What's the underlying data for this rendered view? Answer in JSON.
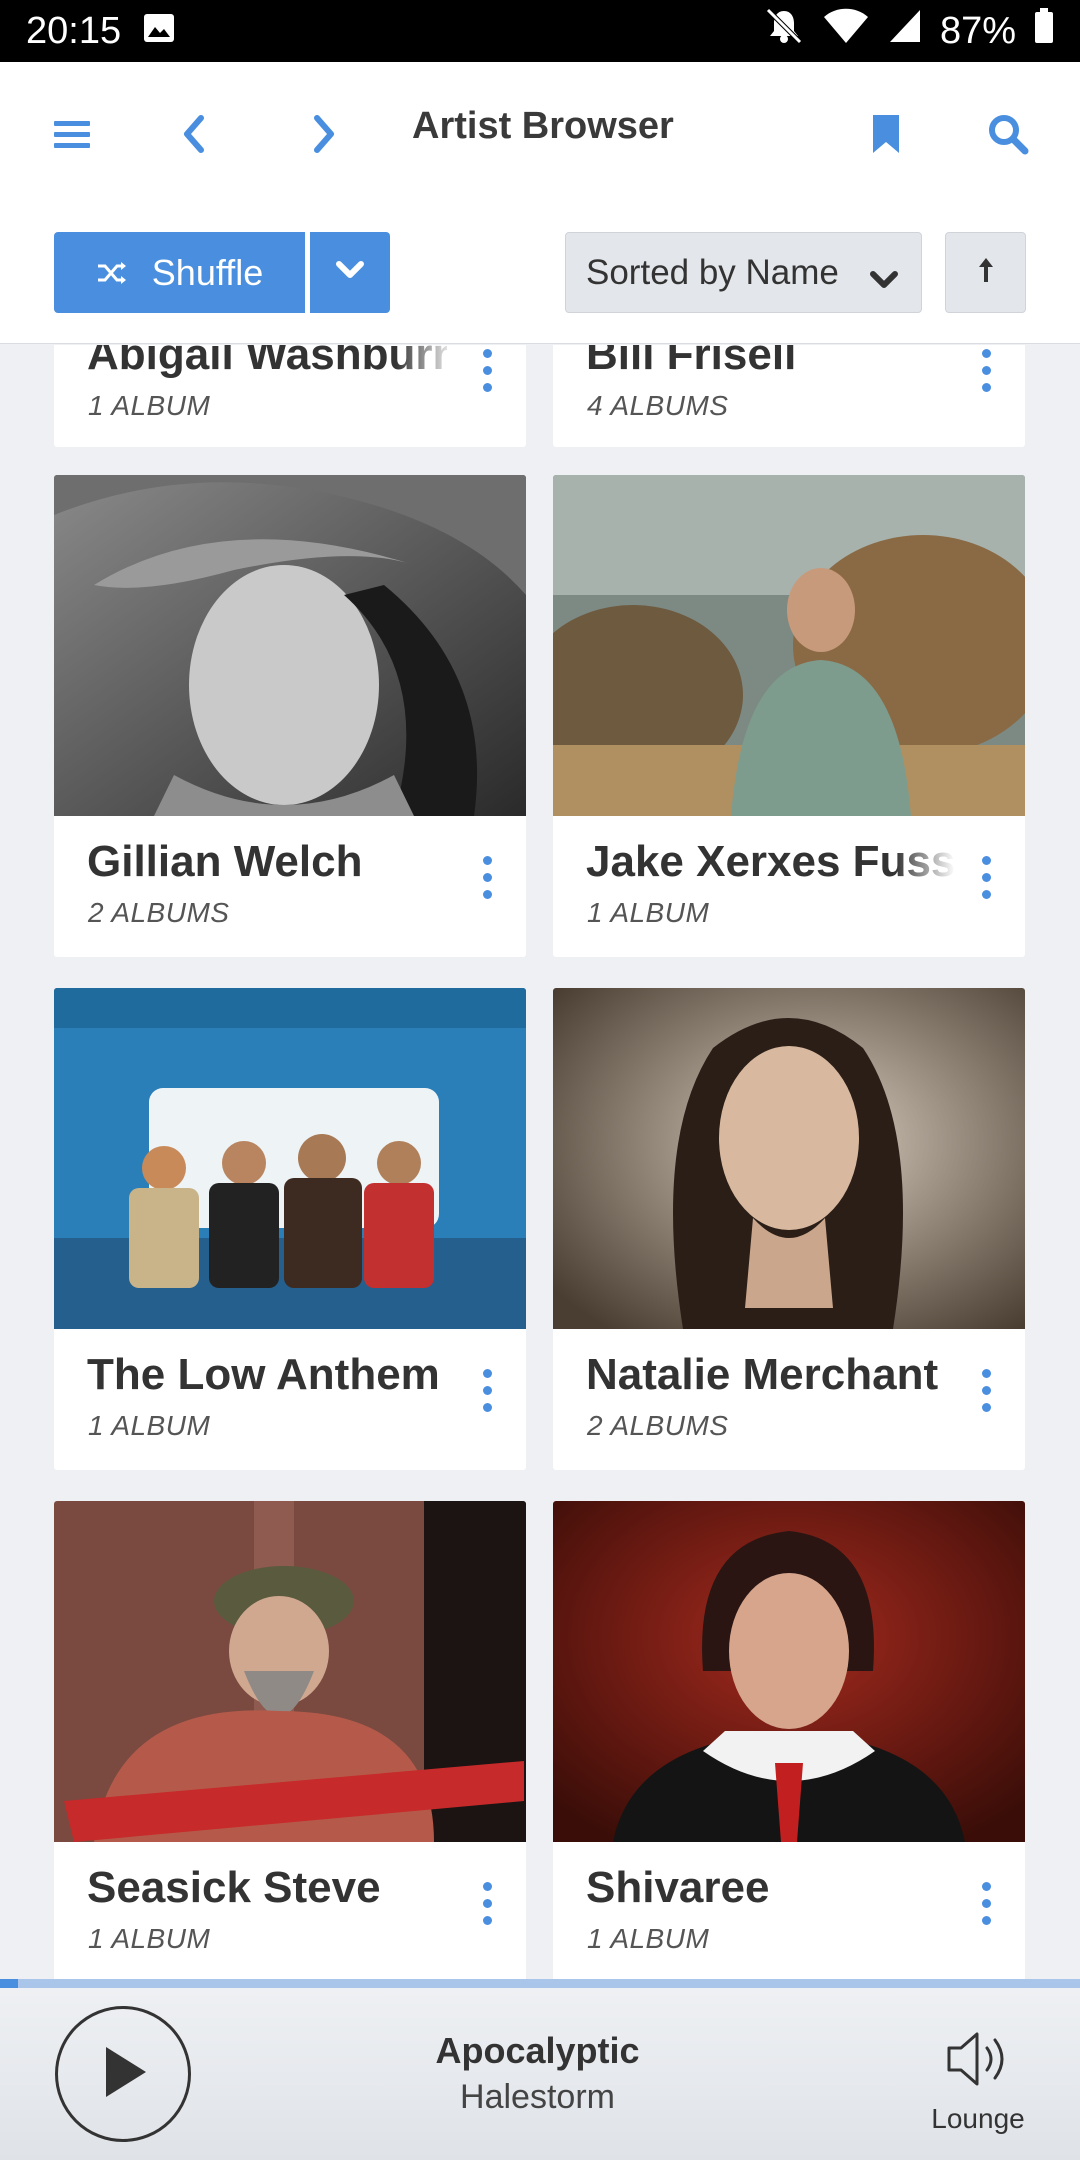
{
  "status_bar": {
    "time": "20:15",
    "battery": "87%"
  },
  "header": {
    "title": "Artist Browser",
    "shuffle_label": "Shuffle",
    "sort_label": "Sorted by Name"
  },
  "artists": [
    {
      "name": "Abigail Washburn",
      "count": "1 ALBUM"
    },
    {
      "name": "Bill Frisell",
      "count": "4 ALBUMS"
    },
    {
      "name": "Gillian Welch",
      "count": "2 ALBUMS"
    },
    {
      "name": "Jake Xerxes Fussell",
      "count": "1 ALBUM"
    },
    {
      "name": "The Low Anthem",
      "count": "1 ALBUM"
    },
    {
      "name": "Natalie Merchant",
      "count": "2 ALBUMS"
    },
    {
      "name": "Seasick Steve",
      "count": "1 ALBUM"
    },
    {
      "name": "Shivaree",
      "count": "1 ALBUM"
    }
  ],
  "now_playing": {
    "title": "Apocalyptic",
    "artist": "Halestorm",
    "zone": "Lounge",
    "progress_fraction": 0.017
  },
  "colors": {
    "accent": "#4a8fdf",
    "background": "#eef0f3"
  }
}
